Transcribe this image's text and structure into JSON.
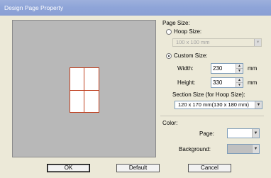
{
  "window": {
    "title": "Design Page Property"
  },
  "page_size": {
    "heading": "Page Size:",
    "hoop_radio_label": "Hoop Size:",
    "hoop_value": "100 x 100 mm",
    "custom_radio_label": "Custom Size:",
    "width_label": "Width:",
    "width_value": "230",
    "height_label": "Height:",
    "height_value": "330",
    "unit": "mm",
    "section_label": "Section Size (for Hoop Size):",
    "section_value": "120 x 170 mm(130 x 180 mm)",
    "selected": "custom"
  },
  "color": {
    "heading": "Color:",
    "page_label": "Page:",
    "background_label": "Background:",
    "page_color": "#ffffff",
    "background_color": "#c0c0c0"
  },
  "buttons": {
    "ok": "OK",
    "default": "Default",
    "cancel": "Cancel"
  },
  "icons": {
    "dropdown": "chevron-down-icon",
    "spin_up": "arrow-up-icon",
    "spin_down": "arrow-down-icon"
  }
}
